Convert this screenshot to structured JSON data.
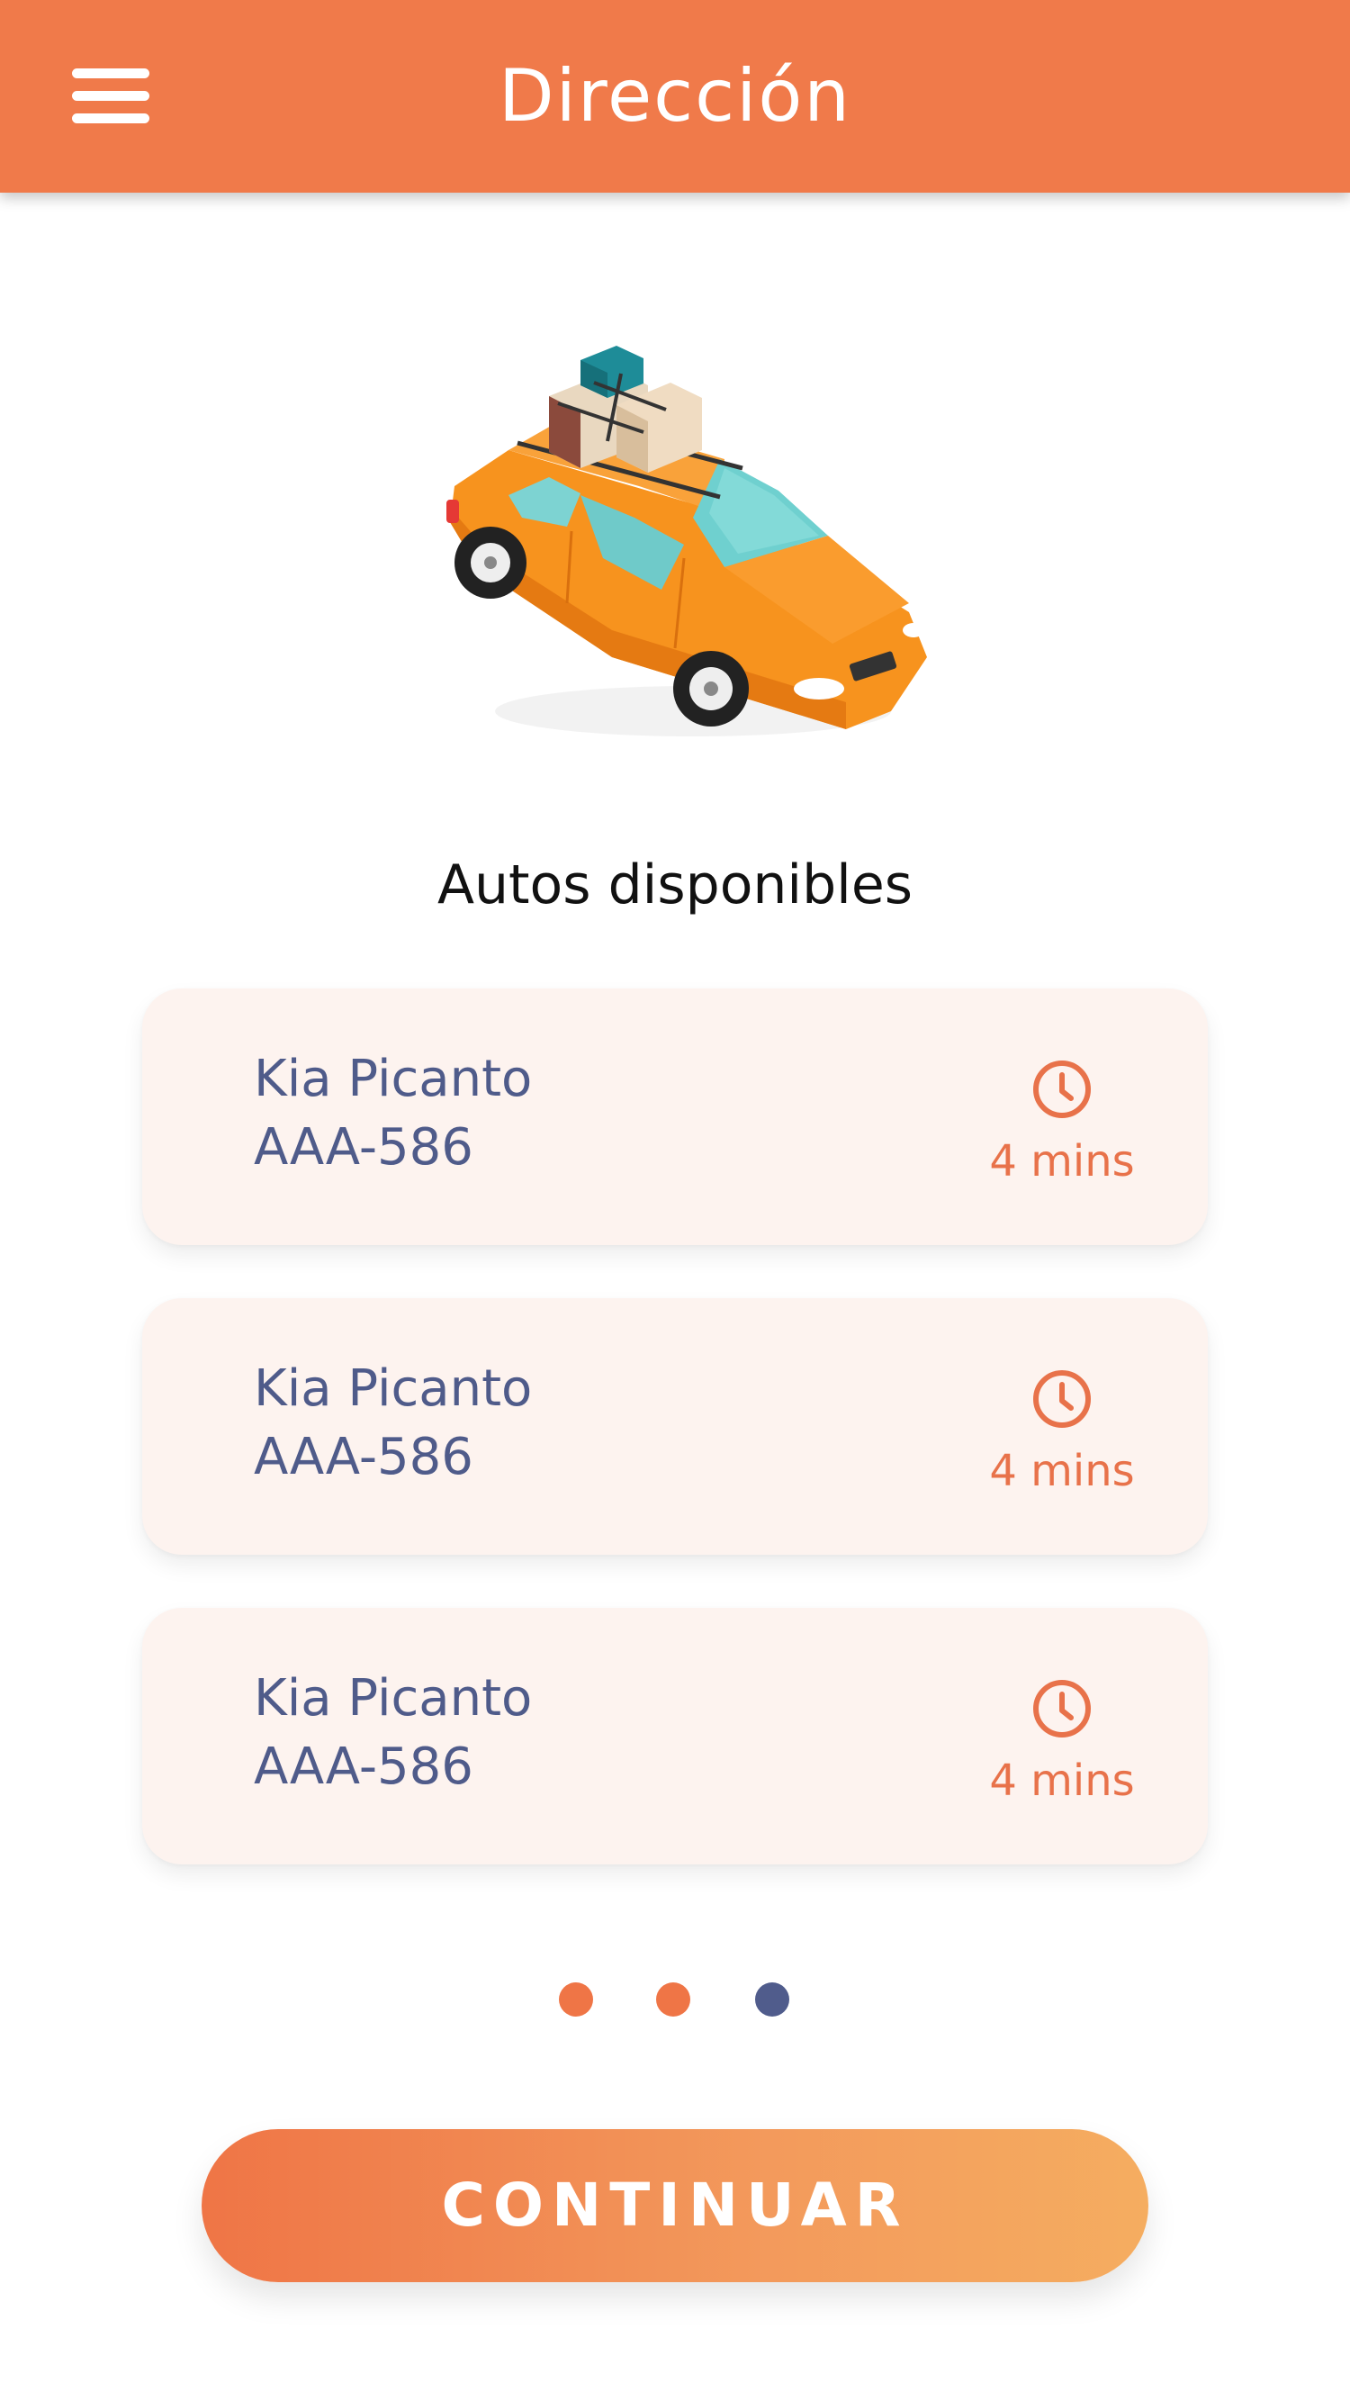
{
  "header": {
    "title": "Dirección",
    "menu_icon": "hamburger-menu-icon",
    "background": "#F07A4A"
  },
  "illustration": {
    "icon": "car-with-luggage-illustration"
  },
  "section": {
    "heading": "Autos disponibles"
  },
  "cars": [
    {
      "model": "Kia Picanto",
      "plate": "AAA-586",
      "eta": "4 mins",
      "icon": "clock-icon"
    },
    {
      "model": "Kia Picanto",
      "plate": "AAA-586",
      "eta": "4 mins",
      "icon": "clock-icon"
    },
    {
      "model": "Kia Picanto",
      "plate": "AAA-586",
      "eta": "4 mins",
      "icon": "clock-icon"
    }
  ],
  "pagination": {
    "total": 3,
    "active_index": 2,
    "inactive_color": "#EF7546",
    "active_color": "#505C8C"
  },
  "actions": {
    "continue_label": "CONTINUAR"
  },
  "colors": {
    "accent": "#F07A4A",
    "card_background": "#FDF3EF",
    "card_text": "#4F5B8A",
    "eta_text": "#E8724A"
  }
}
